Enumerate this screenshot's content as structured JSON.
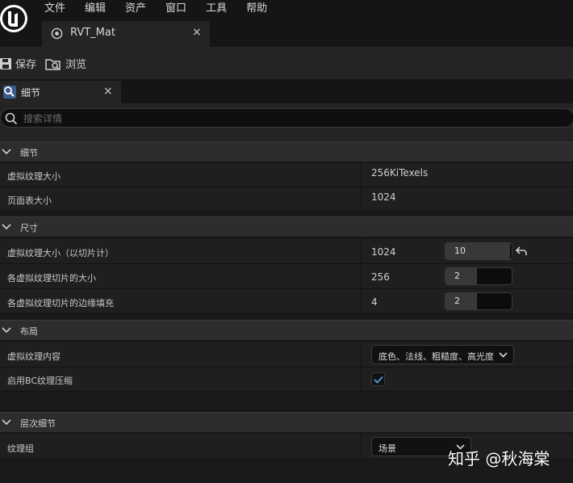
{
  "menu": {
    "items": [
      "文件",
      "编辑",
      "资产",
      "窗口",
      "工具",
      "帮助"
    ]
  },
  "asset_tab": {
    "label": "RVT_Mat",
    "close": "×"
  },
  "toolbar": {
    "save_label": "保存",
    "browse_label": "浏览"
  },
  "details_tab": {
    "label": "细节",
    "close": "×"
  },
  "search": {
    "placeholder": "搜索详情"
  },
  "sections": {
    "details": {
      "title": "细节",
      "rows": [
        {
          "name": "虚拟纹理大小",
          "value": "256KiTexels"
        },
        {
          "name": "页面表大小",
          "value": "1024"
        }
      ]
    },
    "size": {
      "title": "尺寸",
      "rows": [
        {
          "name": "虚拟纹理大小（以切片计）",
          "value": "1024",
          "input": "10",
          "fill": 0.97
        },
        {
          "name": "各虚拟纹理切片的大小",
          "value": "256",
          "input": "2",
          "fill": 0.48
        },
        {
          "name": "各虚拟纹理切片的边缘填充",
          "value": "4",
          "input": "2",
          "fill": 0.48
        }
      ]
    },
    "layout": {
      "title": "布局",
      "rows": [
        {
          "name": "虚拟纹理内容",
          "value": "底色、法线、粗糙度、高光度"
        },
        {
          "name": "启用BC纹理压缩",
          "checked": true
        }
      ]
    },
    "lod": {
      "title": "层次细节",
      "rows": [
        {
          "name": "纹理组",
          "value": "场景"
        }
      ]
    }
  },
  "watermark": "知乎 @秋海棠",
  "colors": {
    "accent": "#4a90d9",
    "panel": "#1f1f1f",
    "section": "#2d2d2d"
  }
}
